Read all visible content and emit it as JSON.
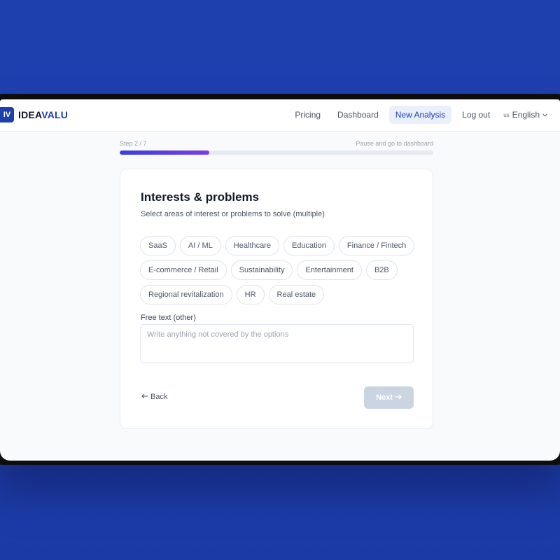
{
  "header": {
    "logo_badge": "IV",
    "logo_text_a": "IDEA",
    "logo_text_b": "VALU",
    "nav": [
      {
        "label": "Pricing"
      },
      {
        "label": "Dashboard"
      },
      {
        "label": "New Analysis",
        "active": true
      },
      {
        "label": "Log out"
      }
    ],
    "language": {
      "flag": "us",
      "label": "English"
    }
  },
  "progress": {
    "step_label": "Step 2 / 7",
    "pause_label": "Pause and go to dashboard",
    "current_step": 2,
    "total_steps": 7
  },
  "card": {
    "title": "Interests & problems",
    "subtitle": "Select areas of interest or problems to solve (multiple)",
    "options": [
      "SaaS",
      "AI / ML",
      "Healthcare",
      "Education",
      "Finance / Fintech",
      "E-commerce / Retail",
      "Sustainability",
      "Entertainment",
      "B2B",
      "Regional revitalization",
      "HR",
      "Real estate"
    ],
    "free_text_label": "Free text (other)",
    "free_text_placeholder": "Write anything not covered by the options",
    "free_text_value": "",
    "back_label": "Back",
    "next_label": "Next"
  },
  "icons": {
    "back": "arrow-left-icon",
    "next": "arrow-right-icon",
    "language_dropdown": "chevron-down-icon"
  },
  "colors": {
    "brand": "#1e40af",
    "progress_start": "#3b3fd8",
    "progress_end": "#7b3ee6",
    "disabled_button": "#cbd5e1"
  }
}
